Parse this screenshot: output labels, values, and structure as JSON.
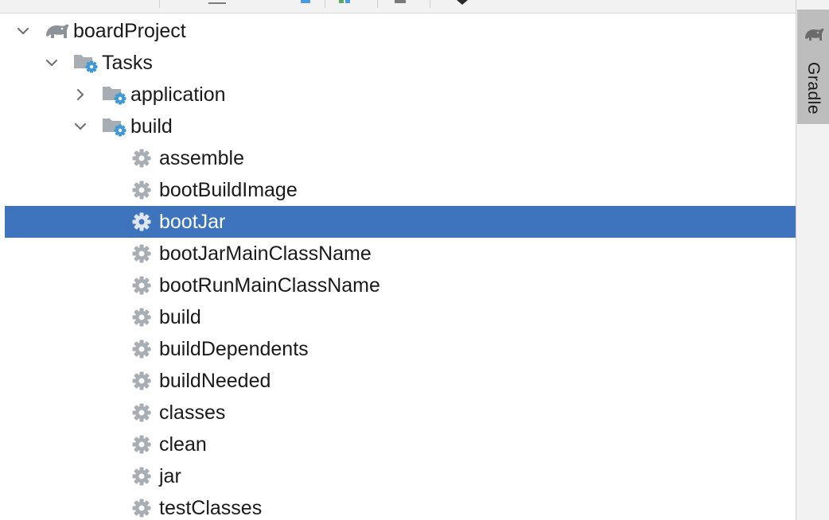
{
  "colors": {
    "selection": "#3d74bd",
    "gear": "#a8adb3",
    "folder": "#a8adb3",
    "folder_gear": "#3d9ad6",
    "chevron": "#6e6e6e"
  },
  "tree": {
    "rows": [
      {
        "label": "boardProject",
        "icon": "gradle-elephant-icon",
        "expanded": true
      },
      {
        "label": "Tasks",
        "icon": "task-folder-icon",
        "expanded": true
      },
      {
        "label": "application",
        "icon": "task-folder-icon",
        "expanded": false
      },
      {
        "label": "build",
        "icon": "task-folder-icon",
        "expanded": true
      },
      {
        "label": "assemble",
        "icon": "gear-icon"
      },
      {
        "label": "bootBuildImage",
        "icon": "gear-icon"
      },
      {
        "label": "bootJar",
        "icon": "gear-icon",
        "selected": true
      },
      {
        "label": "bootJarMainClassName",
        "icon": "gear-icon"
      },
      {
        "label": "bootRunMainClassName",
        "icon": "gear-icon"
      },
      {
        "label": "build",
        "icon": "gear-icon"
      },
      {
        "label": "buildDependents",
        "icon": "gear-icon"
      },
      {
        "label": "buildNeeded",
        "icon": "gear-icon"
      },
      {
        "label": "classes",
        "icon": "gear-icon"
      },
      {
        "label": "clean",
        "icon": "gear-icon"
      },
      {
        "label": "jar",
        "icon": "gear-icon"
      },
      {
        "label": "testClasses",
        "icon": "gear-icon"
      }
    ]
  },
  "sidebar": {
    "gradle_tab_label": "Gradle",
    "gradle_tab_icon": "gradle-elephant-icon"
  }
}
